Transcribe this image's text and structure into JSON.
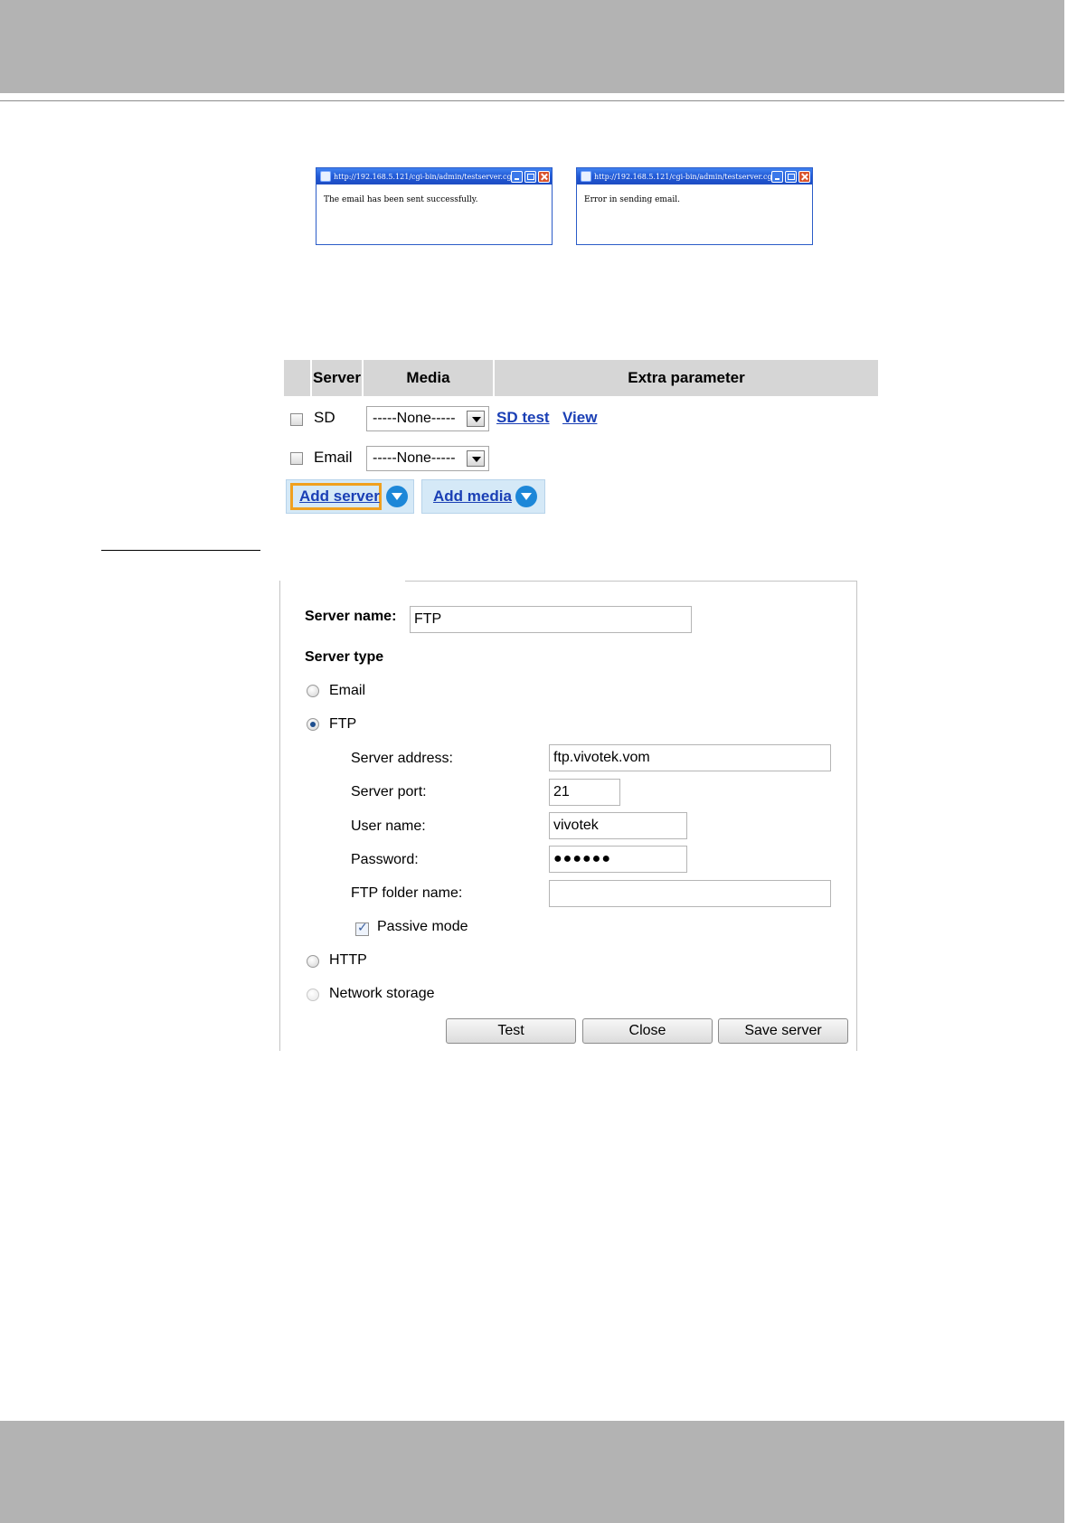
{
  "popups": [
    {
      "title": "http://192.168.5.121/cgi-bin/admin/testserver.cgi - ...",
      "message": "The email has been sent successfully."
    },
    {
      "title": "http://192.168.5.121/cgi-bin/admin/testserver.cgi - ...",
      "message": "Error in sending email."
    }
  ],
  "table": {
    "headers": {
      "server": "Server",
      "media": "Media",
      "extra": "Extra parameter"
    },
    "rows": [
      {
        "server": "SD",
        "media": "-----None-----",
        "links": [
          "SD test",
          "View"
        ]
      },
      {
        "server": "Email",
        "media": "-----None-----",
        "links": []
      }
    ],
    "add_server_label": "Add server",
    "add_media_label": "Add media"
  },
  "form": {
    "server_name_label": "Server name:",
    "server_name_value": "FTP",
    "server_type_label": "Server type",
    "types": {
      "email": "Email",
      "ftp": "FTP",
      "http": "HTTP",
      "network_storage": "Network storage"
    },
    "selected_type": "FTP",
    "ftp": {
      "server_address_label": "Server address:",
      "server_address_value": "ftp.vivotek.vom",
      "server_port_label": "Server port:",
      "server_port_value": "21",
      "user_name_label": "User name:",
      "user_name_value": "vivotek",
      "password_label": "Password:",
      "password_mask": "●●●●●●",
      "folder_label": "FTP folder name:",
      "folder_value": "",
      "passive_label": "Passive mode",
      "passive_checked": true
    },
    "buttons": {
      "test": "Test",
      "close": "Close",
      "save": "Save server"
    }
  }
}
